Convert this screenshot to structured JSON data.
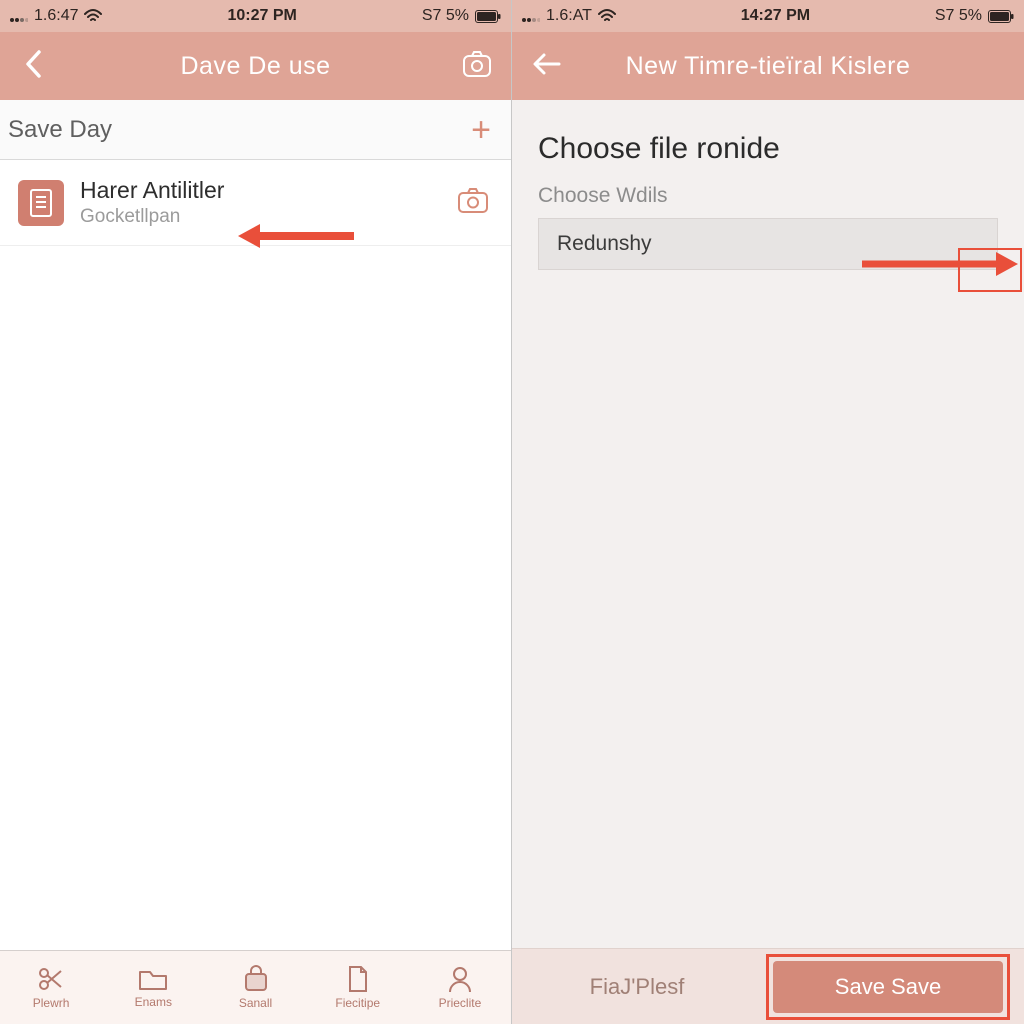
{
  "colors": {
    "accent": "#d48a7a",
    "annotation": "#e94f3a"
  },
  "left": {
    "status": {
      "carrier": "1.6:47",
      "time": "10:27 PM",
      "extra": "S7 5%"
    },
    "nav": {
      "title": "Dave De use",
      "back_icon": "chevron-left",
      "right_icon": "camera-outline"
    },
    "section": {
      "title": "Save Day",
      "action_icon": "plus"
    },
    "items": [
      {
        "icon": "document",
        "title": "Harer Antilitler",
        "subtitle": "Gocketllpan",
        "trailing_icon": "camera-outline"
      }
    ],
    "tabs": [
      {
        "icon": "scissors",
        "label": "Plewrh"
      },
      {
        "icon": "folder",
        "label": "Enams"
      },
      {
        "icon": "bag",
        "label": "Sanall"
      },
      {
        "icon": "page",
        "label": "Fiecitipe"
      },
      {
        "icon": "person",
        "label": "Prieclite"
      }
    ]
  },
  "right": {
    "status": {
      "carrier": "1.6:AT",
      "time": "14:27 PM",
      "extra": "S7 5%"
    },
    "nav": {
      "title": "New Timre-tieïral Kislere",
      "back_icon": "arrow-left"
    },
    "heading": "Choose file ronide",
    "subheading": "Choose Wdils",
    "options": [
      {
        "label": "Redunshy"
      }
    ],
    "footer": {
      "left_label": "FiaJ'Plesf",
      "save_label": "Save Save"
    }
  }
}
